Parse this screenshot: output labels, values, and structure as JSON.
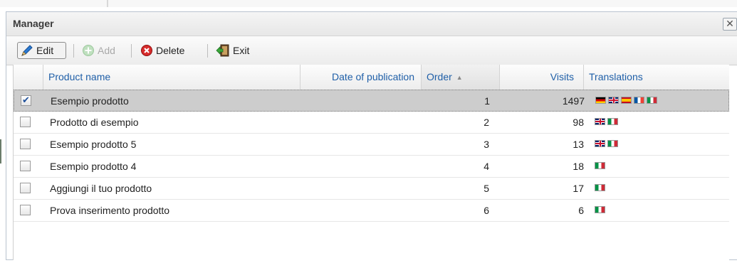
{
  "window": {
    "title": "Manager",
    "close_symbol": "✕"
  },
  "toolbar": {
    "edit_label": "Edit",
    "add_label": "Add",
    "delete_label": "Delete",
    "exit_label": "Exit",
    "separator": "|"
  },
  "table": {
    "columns": {
      "product_name": "Product name",
      "date_of_publication": "Date of publication",
      "order": "Order",
      "visits": "Visits",
      "translations": "Translations"
    },
    "sort_indicator": "▲",
    "rows": [
      {
        "checked": true,
        "name": "Esempio prodotto",
        "date": "",
        "order": "1",
        "visits": "1497",
        "translations": [
          "de",
          "gb",
          "es",
          "fr",
          "it"
        ]
      },
      {
        "checked": false,
        "name": "Prodotto di esempio",
        "date": "",
        "order": "2",
        "visits": "98",
        "translations": [
          "gb",
          "it"
        ]
      },
      {
        "checked": false,
        "name": "Esempio prodotto 5",
        "date": "",
        "order": "3",
        "visits": "13",
        "translations": [
          "gb",
          "it"
        ]
      },
      {
        "checked": false,
        "name": "Esempio prodotto 4",
        "date": "",
        "order": "4",
        "visits": "18",
        "translations": [
          "it"
        ]
      },
      {
        "checked": false,
        "name": "Aggiungi il tuo prodotto",
        "date": "",
        "order": "5",
        "visits": "17",
        "translations": [
          "it"
        ]
      },
      {
        "checked": false,
        "name": "Prova inserimento prodotto",
        "date": "",
        "order": "6",
        "visits": "6",
        "translations": [
          "it"
        ]
      }
    ]
  },
  "colors": {
    "header_text": "#1f5fa8",
    "selected_row": "#cdcdcd",
    "add_disabled": "#a9a9a9"
  }
}
